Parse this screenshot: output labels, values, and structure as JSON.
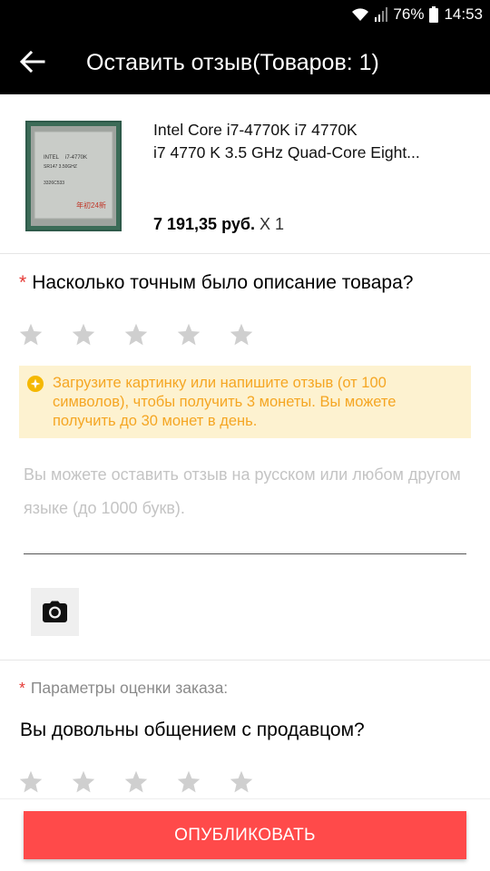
{
  "status_bar": {
    "battery": "76%",
    "time": "14:53",
    "wifi_icon": "wifi-icon",
    "signal_icon": "signal-icon",
    "battery_icon": "battery-icon"
  },
  "header": {
    "title": "Оставить отзыв(Товаров: 1)",
    "back_icon": "arrow-left-icon"
  },
  "product": {
    "title_line1": "Intel Core i7-4770K i7 4770K",
    "title_line2": "i7 4770 K 3.5 GHz Quad-Core Eight...",
    "price": "7 191,35 руб.",
    "quantity": "X 1",
    "image_text": {
      "brand": "INTEL",
      "model": "i7-4770K",
      "code": "SR147 3.50GHZ",
      "batch": "3326C533",
      "seller_mark": "年初24新"
    }
  },
  "rating_question": {
    "required_mark": "*",
    "text": "Насколько точным было описание товара?",
    "stars": 5,
    "value": 0
  },
  "notice": {
    "icon": "coin-icon",
    "text": "Загрузите картинку или напишите отзыв (от 100 символов), чтобы получить 3 монеты. Вы можете получить до 30 монет в день.",
    "color": "#f5a623",
    "background": "#fdf2d0"
  },
  "review": {
    "value": "",
    "placeholder": "Вы можете оставить отзыв на русском или любом другом языке (до 1000 букв)."
  },
  "photo_button": {
    "icon": "camera-icon"
  },
  "order_params": {
    "required_mark": "*",
    "label": "Параметры оценки заказа:"
  },
  "seller_question": {
    "text": "Вы довольны общением с продавцом?",
    "stars": 5,
    "value": 0
  },
  "publish_button": {
    "label": "ОПУБЛИКОВАТЬ",
    "color": "#ff4a4a"
  },
  "colors": {
    "star_empty": "#cfcfcf",
    "required": "#e53935",
    "appbar": "#000000"
  }
}
